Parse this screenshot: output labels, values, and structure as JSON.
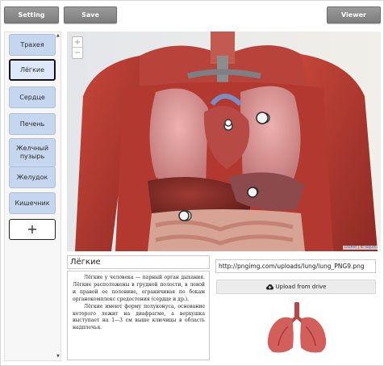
{
  "toolbar": {
    "setting_label": "Setting",
    "save_label": "Save",
    "viewer_label": "Viewer"
  },
  "sidebar": {
    "items": [
      {
        "label": "Трахея"
      },
      {
        "label": "Лёгкие"
      },
      {
        "label": "Сердце"
      },
      {
        "label": "Печень"
      },
      {
        "label": "Желчный пузырь"
      },
      {
        "label": "Желудок"
      },
      {
        "label": "Кишечник"
      }
    ],
    "add_label": "+"
  },
  "map": {
    "zoom_in": "+",
    "zoom_out": "−",
    "attribution_leaflet": "Leaflet",
    "attribution_sep": " | © ",
    "attribution_owner": "loquitu"
  },
  "editor": {
    "title_value": "Лёгкие",
    "description": [
      "Лёгкие у человека — парный орган дыхания. Лёгкие расположены в грудной полости, в левой и правой ее половине, ограничивая по бокам органокомплекс средостения (сердце и др.).",
      "Лёгкие имеют форму полуконуса, основание которого лежит на диафрагме, а верхушка выступает на 1—3 см выше ключицы в область надплечья."
    ]
  },
  "media": {
    "url_value": "http://pngimg.com/uploads/lung/lung_PNG9.png",
    "upload_label": "Upload from drive"
  },
  "colors": {
    "nav_bg": "#c6d6ee",
    "toolbar_bg": "#8a8a8a",
    "muscle_red": "#b4372f",
    "organ_pink": "#d98b8d"
  }
}
